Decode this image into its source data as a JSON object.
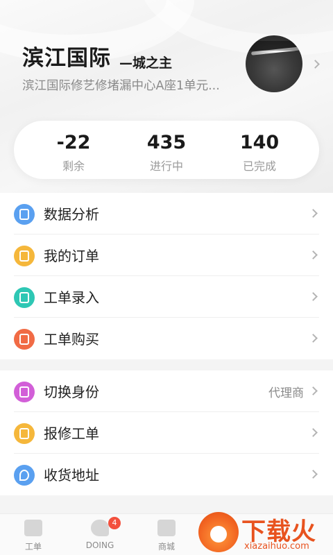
{
  "profile": {
    "name": "滨江国际",
    "title": "—城之主",
    "address": "滨江国际修艺修堵漏中心A座1单元..."
  },
  "stats": [
    {
      "value": "-22",
      "label": "剩余"
    },
    {
      "value": "435",
      "label": "进行中"
    },
    {
      "value": "140",
      "label": "已完成"
    }
  ],
  "menu_group1": [
    {
      "label": "数据分析",
      "icon": "data-analysis-icon",
      "color": "#5aa0f0"
    },
    {
      "label": "我的订单",
      "icon": "order-icon",
      "color": "#f5b73b"
    },
    {
      "label": "工单录入",
      "icon": "edit-icon",
      "color": "#2ec7b4"
    },
    {
      "label": "工单购买",
      "icon": "cart-icon",
      "color": "#f16b45"
    }
  ],
  "menu_group2": [
    {
      "label": "切换身份",
      "icon": "switch-identity-icon",
      "color": "#d25fd8",
      "value": "代理商"
    },
    {
      "label": "报修工单",
      "icon": "repair-icon",
      "color": "#f5b73b"
    },
    {
      "label": "收货地址",
      "icon": "location-icon",
      "color": "#5aa0f0"
    }
  ],
  "tabbar": [
    {
      "label": "工单"
    },
    {
      "label": "DOING",
      "badge": "4"
    },
    {
      "label": "商城"
    }
  ],
  "watermark": {
    "text": "下载火",
    "url": "xiazaihuo.com"
  }
}
